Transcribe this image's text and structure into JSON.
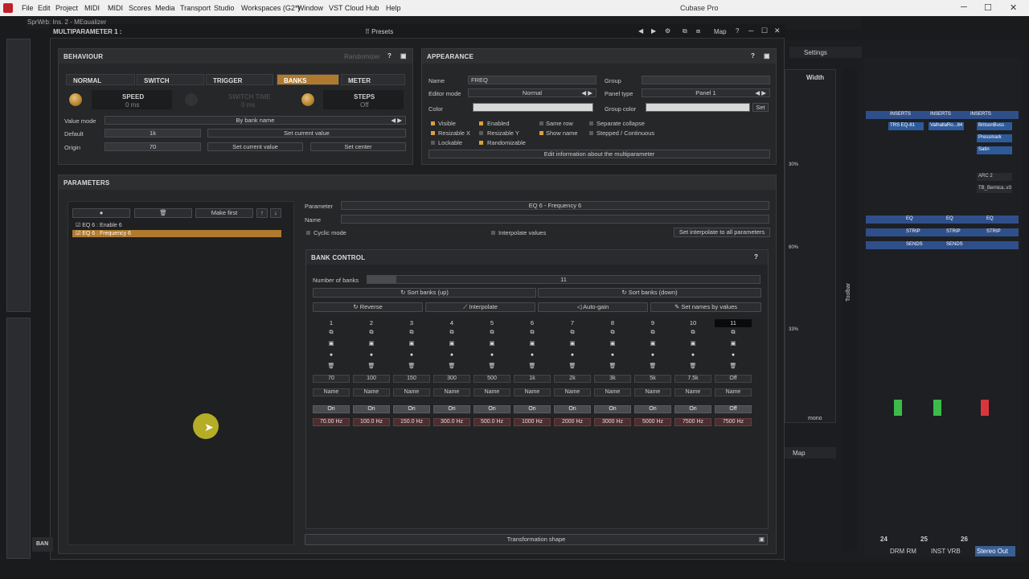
{
  "menubar": {
    "items": [
      "File",
      "Edit",
      "Project",
      "MIDI",
      "Scores",
      "Media",
      "Transport",
      "Studio",
      "Workspaces (G2*)",
      "Window",
      "VST Cloud",
      "Hub",
      "Help"
    ],
    "title": "Cubase Pro"
  },
  "plugin_title": "SprWrb: Ins. 2 - MEqualizer",
  "window": {
    "title": "MULTIPARAMETER 1 :",
    "presets": "Presets",
    "map": "Map",
    "help": "?"
  },
  "behaviour": {
    "title": "BEHAVIOUR",
    "randomizer": "Randomizer",
    "help": "?",
    "tabs": [
      "NORMAL",
      "SWITCH",
      "TRIGGER",
      "BANKS",
      "METER"
    ],
    "active_tab": "BANKS",
    "speed_label": "SPEED",
    "speed_value": "0 ms",
    "switch_time_label": "SWITCH TIME",
    "switch_time_value": "0 ms",
    "steps_label": "STEPS",
    "steps_value": "Off",
    "value_mode_label": "Value mode",
    "value_mode": "By bank name",
    "default_label": "Default",
    "default_value": "1k",
    "set_current_value": "Set current value",
    "origin_label": "Origin",
    "origin_value": "70",
    "set_current_value2": "Set current value",
    "set_center": "Set center"
  },
  "appearance": {
    "title": "APPEARANCE",
    "help": "?",
    "name_label": "Name",
    "name_value": "FREQ",
    "group_label": "Group",
    "editor_mode_label": "Editor mode",
    "editor_mode": "Normal",
    "panel_type_label": "Panel type",
    "panel_type": "Panel 1",
    "color_label": "Color",
    "group_color_label": "Group color",
    "set": "Set",
    "checks": [
      {
        "label": "Visible",
        "on": true
      },
      {
        "label": "Enabled",
        "on": true
      },
      {
        "label": "Same row",
        "on": false
      },
      {
        "label": "Separate collapse",
        "on": false
      },
      {
        "label": "Resizable X",
        "on": true
      },
      {
        "label": "Resizable Y",
        "on": false
      },
      {
        "label": "Show name",
        "on": true
      },
      {
        "label": "Stepped / Continuous",
        "on": false
      },
      {
        "label": "Lockable",
        "on": false
      },
      {
        "label": "Randomizable",
        "on": true
      }
    ],
    "edit_info": "Edit information about the multiparameter"
  },
  "parameters": {
    "title": "PARAMETERS",
    "make_first": "Make first",
    "up": "↑",
    "down": "↓",
    "list": [
      "EQ 6 : Enable 6",
      "EQ 6 : Frequency 6"
    ],
    "parameter_label": "Parameter",
    "parameter_value": "EQ 6 - Frequency 6",
    "name_label": "Name",
    "cyclic_mode": "Cyclic mode",
    "interpolate_values": "Interpolate values",
    "set_interpolate": "Set interpolate to all parameters"
  },
  "bank_control": {
    "title": "BANK CONTROL",
    "help": "?",
    "number_of_banks_label": "Number of banks",
    "number_of_banks": "11",
    "sort_up": "Sort banks (up)",
    "sort_down": "Sort banks (down)",
    "reverse": "Reverse",
    "interpolate": "Interpolate",
    "auto_gain": "Auto-gain",
    "set_names": "Set names by values",
    "banks": [
      {
        "n": "1",
        "val": "70",
        "name": "Name",
        "on": "On",
        "hz": "70.00 Hz"
      },
      {
        "n": "2",
        "val": "100",
        "name": "Name",
        "on": "On",
        "hz": "100.0 Hz"
      },
      {
        "n": "3",
        "val": "150",
        "name": "Name",
        "on": "On",
        "hz": "150.0 Hz"
      },
      {
        "n": "4",
        "val": "300",
        "name": "Name",
        "on": "On",
        "hz": "300.0 Hz"
      },
      {
        "n": "5",
        "val": "500",
        "name": "Name",
        "on": "On",
        "hz": "500.0 Hz"
      },
      {
        "n": "6",
        "val": "1k",
        "name": "Name",
        "on": "On",
        "hz": "1000 Hz"
      },
      {
        "n": "7",
        "val": "2k",
        "name": "Name",
        "on": "On",
        "hz": "2000 Hz"
      },
      {
        "n": "8",
        "val": "3k",
        "name": "Name",
        "on": "On",
        "hz": "3000 Hz"
      },
      {
        "n": "9",
        "val": "5k",
        "name": "Name",
        "on": "On",
        "hz": "5000 Hz"
      },
      {
        "n": "10",
        "val": "7.5k",
        "name": "Name",
        "on": "On",
        "hz": "7500 Hz"
      },
      {
        "n": "11",
        "val": "Off",
        "name": "Name",
        "on": "Off",
        "hz": "7500 Hz"
      }
    ],
    "transformation_shape": "Transformation shape"
  },
  "right": {
    "settings": "Settings",
    "width": "Width",
    "mono": "mono",
    "toolbar": "Toolbar",
    "map": "Map",
    "pct": [
      "30%",
      "60%",
      "33%"
    ],
    "channels": [
      "DRM RM",
      "INST VRB",
      "Stereo Out"
    ],
    "nums": [
      "24",
      "25",
      "26"
    ],
    "inserts": "INSERTS",
    "eq": "EQ",
    "strip": "STRIP",
    "sends": "SENDS",
    "insert_items": [
      "TRS EQ-81",
      "ValhallaRo...84",
      "BritsonBuss",
      "Pressmark",
      "Satin",
      "ARC 2",
      "TB_Bernica..v3"
    ]
  },
  "colors": {
    "accent": "#b07a2e",
    "bank_active": "#0a0a0a"
  }
}
